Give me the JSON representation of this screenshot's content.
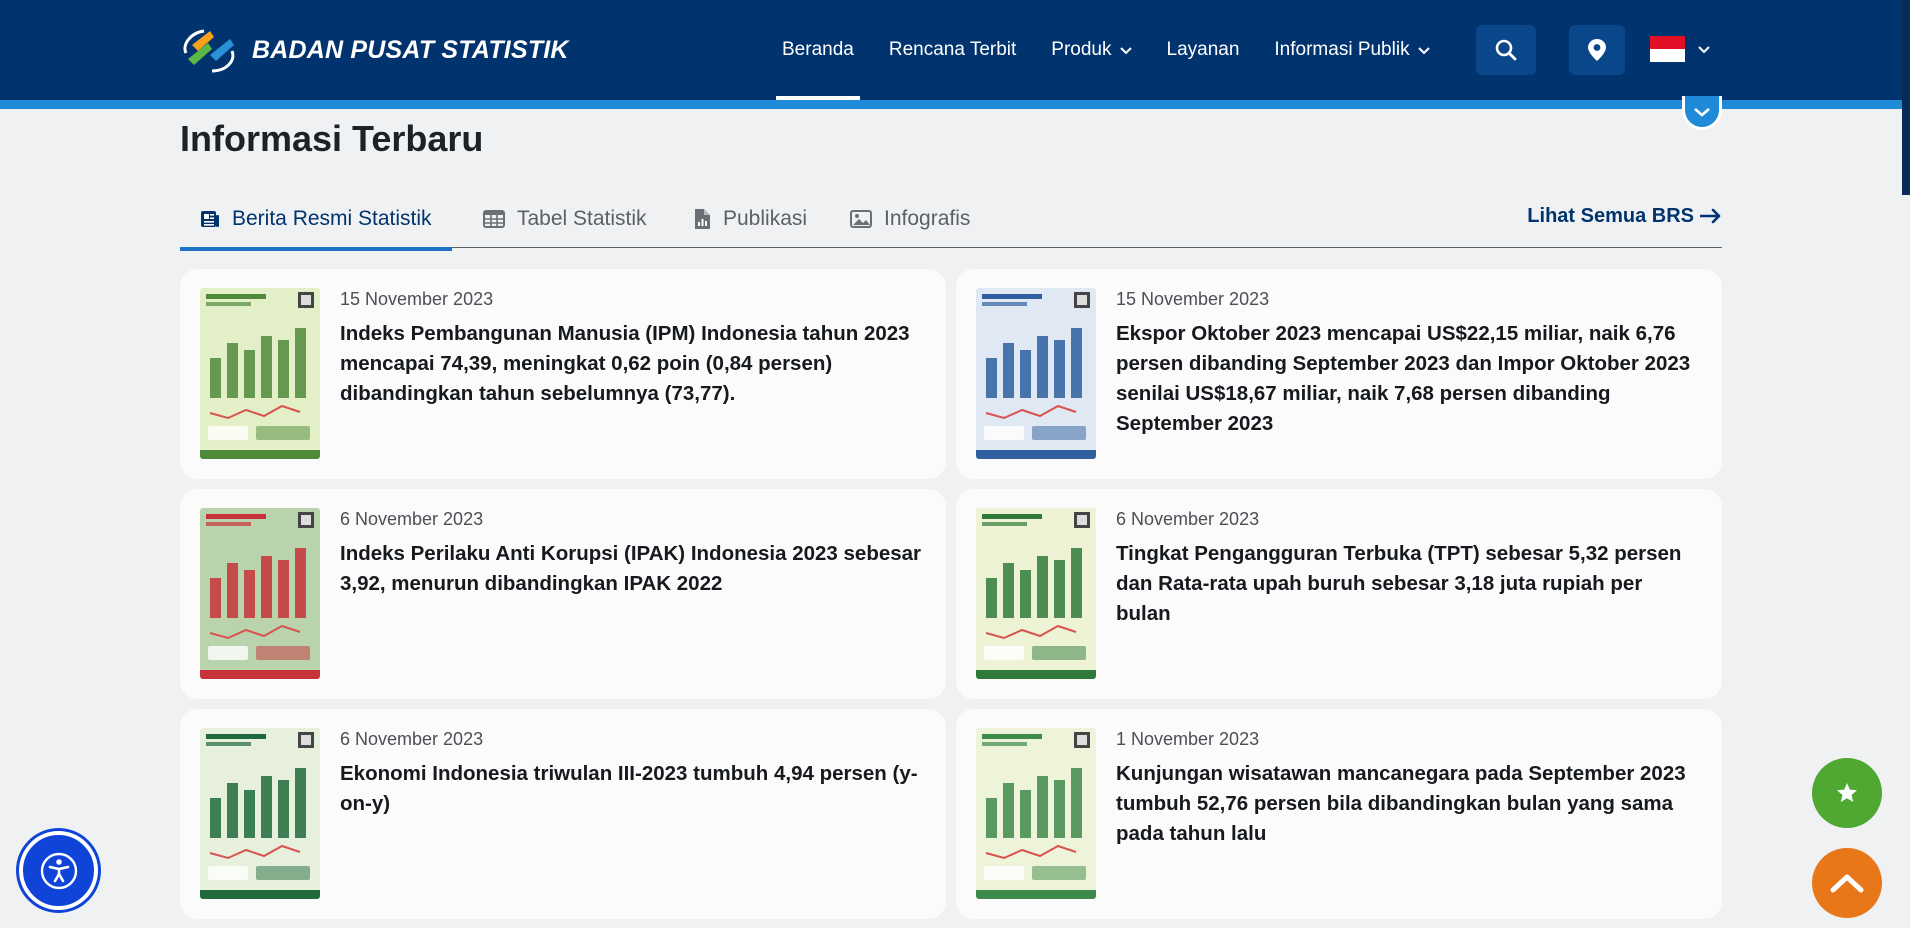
{
  "header": {
    "logo_text": "BADAN PUSAT STATISTIK",
    "nav": [
      {
        "label": "Beranda",
        "active": true
      },
      {
        "label": "Rencana Terbit"
      },
      {
        "label": "Produk",
        "dropdown": true
      },
      {
        "label": "Layanan"
      },
      {
        "label": "Informasi Publik",
        "dropdown": true
      }
    ],
    "search_icon": "search-icon",
    "location_icon": "location-pin-icon",
    "language_flag": "indonesia-flag"
  },
  "section": {
    "title": "Informasi Terbaru",
    "tabs": [
      {
        "label": "Berita Resmi Statistik",
        "icon": "newspaper-icon",
        "active": true
      },
      {
        "label": "Tabel Statistik",
        "icon": "table-icon"
      },
      {
        "label": "Publikasi",
        "icon": "file-chart-icon"
      },
      {
        "label": "Infografis",
        "icon": "image-icon"
      }
    ],
    "see_all": "Lihat Semua BRS",
    "see_all_icon": "arrow-right-icon"
  },
  "cards": [
    {
      "date": "15 November 2023",
      "title": "Indeks Pembangunan Manusia (IPM) Indonesia tahun 2023 mencapai 74,39, meningkat 0,62 poin (0,84 persen) dibandingkan tahun sebelumnya (73,77).",
      "thumb_bg": "#e3efc7",
      "thumb_accent": "#4e8a3a"
    },
    {
      "date": "15 November 2023",
      "title": "Ekspor Oktober 2023 mencapai US$22,15 miliar, naik 6,76 persen dibanding September 2023 dan Impor Oktober 2023 senilai US$18,67 miliar, naik 7,68 persen dibanding September 2023",
      "thumb_bg": "#dfe8f3",
      "thumb_accent": "#2f5f9e"
    },
    {
      "date": "6 November 2023",
      "title": "Indeks Perilaku Anti Korupsi (IPAK) Indonesia 2023 sebesar 3,92, menurun dibandingkan IPAK 2022",
      "thumb_bg": "#b9d3ac",
      "thumb_accent": "#c7333a"
    },
    {
      "date": "6 November 2023",
      "title": "Tingkat Pengangguran Terbuka (TPT) sebesar 5,32 persen dan Rata-rata upah buruh sebesar 3,18 juta rupiah per bulan",
      "thumb_bg": "#eef3d6",
      "thumb_accent": "#2f7a3a"
    },
    {
      "date": "6 November 2023",
      "title": "Ekonomi Indonesia triwulan III-2023 tumbuh 4,94 persen (y-on-y)",
      "thumb_bg": "#e6f0dc",
      "thumb_accent": "#1f6a3a"
    },
    {
      "date": "1 November 2023",
      "title": "Kunjungan wisatawan mancanegara pada September 2023 tumbuh 52,76 persen bila dibandingkan bulan yang sama pada tahun lalu",
      "thumb_bg": "#eef4d9",
      "thumb_accent": "#3d8a4a"
    }
  ],
  "floating": {
    "accessibility_icon": "accessibility-icon",
    "favorite_icon": "star-icon",
    "back_to_top_icon": "chevron-up-icon"
  }
}
